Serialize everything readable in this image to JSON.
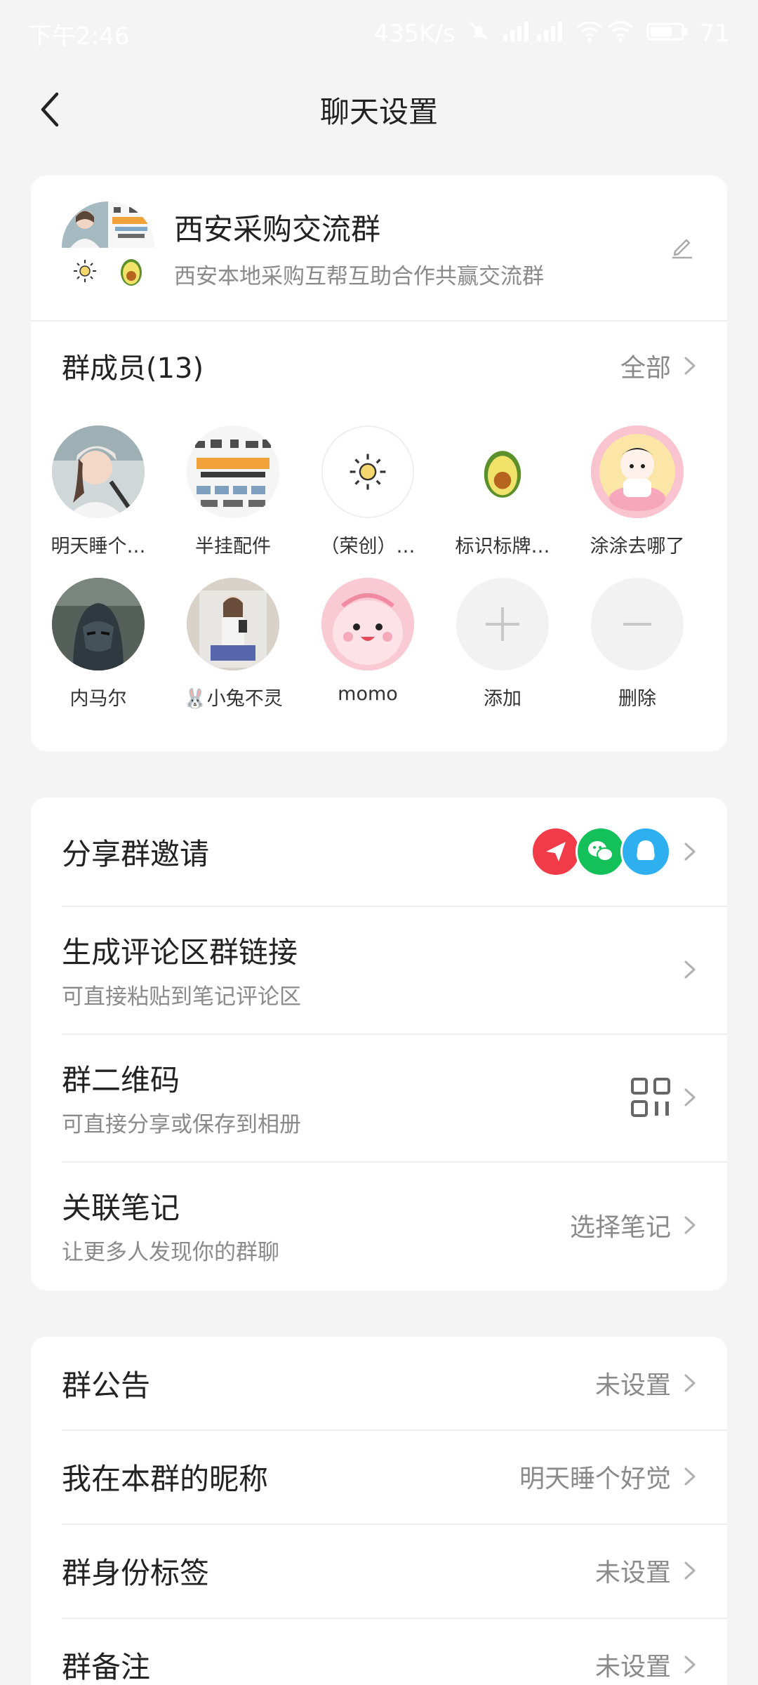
{
  "status_bar": {
    "time": "下午2:46",
    "net_speed": "435K/s",
    "battery": "71"
  },
  "nav": {
    "title": "聊天设置"
  },
  "group": {
    "name": "西安采购交流群",
    "description": "西安本地采购互帮互助合作共赢交流群"
  },
  "members": {
    "title": "群成员(13)",
    "all_label": "全部",
    "items": [
      {
        "name": "明天睡个…",
        "icon": "woman-photo-avatar"
      },
      {
        "name": "半挂配件",
        "icon": "truck-parts-avatar"
      },
      {
        "name": "（荣创）…",
        "icon": "sun-avatar"
      },
      {
        "name": "标识标牌…",
        "icon": "avocado-avatar"
      },
      {
        "name": "涂涂去哪了",
        "icon": "cartoon-girl-avatar"
      },
      {
        "name": "内马尔",
        "icon": "helmet-hero-avatar"
      },
      {
        "name": "🐰小兔不灵",
        "icon": "mirror-selfie-avatar"
      },
      {
        "name": "momo",
        "icon": "pink-blob-avatar"
      },
      {
        "name": "添加",
        "icon": "plus-icon"
      },
      {
        "name": "删除",
        "icon": "minus-icon"
      }
    ]
  },
  "share_section": {
    "invite": {
      "title": "分享群邀请",
      "icons": [
        "paper-plane-icon",
        "wechat-icon",
        "qq-icon"
      ]
    },
    "comment_link": {
      "title": "生成评论区群链接",
      "subtitle": "可直接粘贴到笔记评论区"
    },
    "qr_code": {
      "title": "群二维码",
      "subtitle": "可直接分享或保存到相册",
      "icon": "qr-code-icon"
    },
    "linked_note": {
      "title": "关联笔记",
      "subtitle": "让更多人发现你的群聊",
      "value": "选择笔记"
    }
  },
  "settings_section": {
    "announcement": {
      "title": "群公告",
      "value": "未设置"
    },
    "nickname": {
      "title": "我在本群的昵称",
      "value": "明天睡个好觉"
    },
    "identity_tag": {
      "title": "群身份标签",
      "value": "未设置"
    },
    "remark": {
      "title": "群备注",
      "value": "未设置"
    }
  },
  "colors": {
    "background": "#f4f4f4",
    "card": "#ffffff",
    "muted_text": "#8a8a8a",
    "share_red": "#f23b48",
    "wechat_green": "#14c05a",
    "qq_blue": "#2eb0f0"
  }
}
